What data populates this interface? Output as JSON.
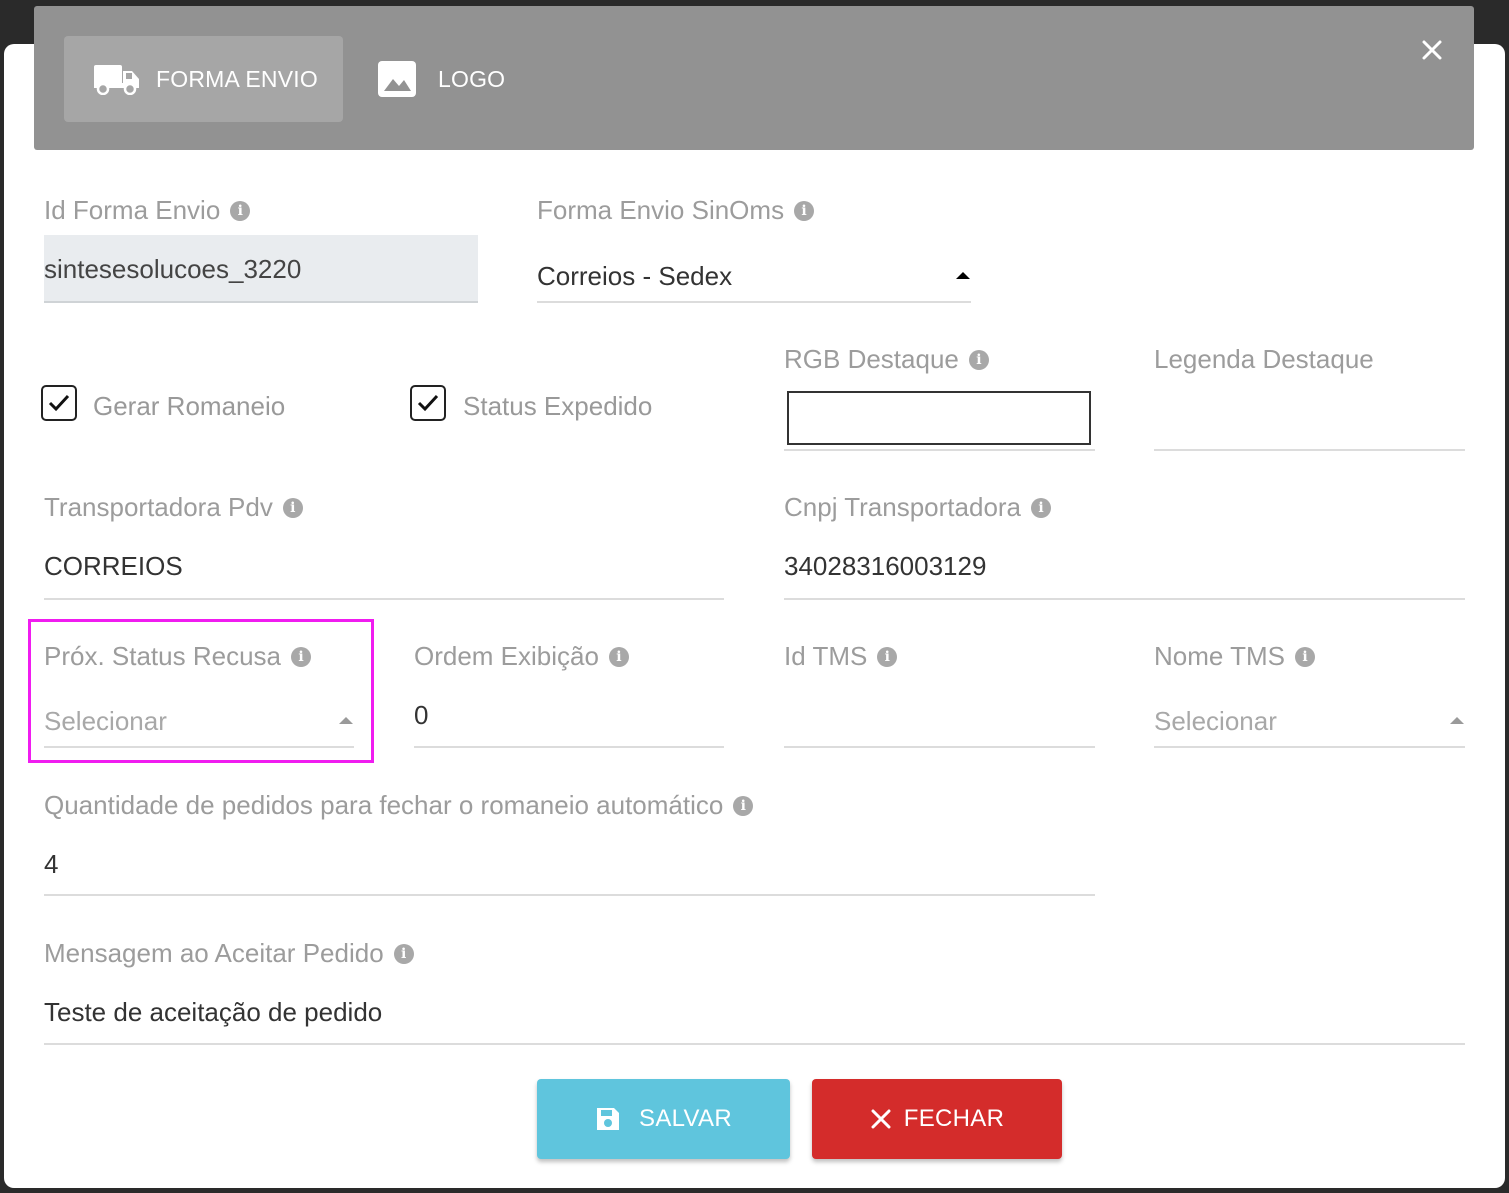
{
  "header": {
    "tabs": [
      {
        "label": "FORMA ENVIO",
        "icon": "truck-icon",
        "active": true
      },
      {
        "label": "LOGO",
        "icon": "image-icon",
        "active": false
      }
    ],
    "close_icon": "close-icon"
  },
  "form": {
    "id_forma_envio": {
      "label": "Id Forma Envio",
      "value": "sintesesolucoes_3220"
    },
    "forma_envio_sinoms": {
      "label": "Forma Envio SinOms",
      "value": "Correios - Sedex"
    },
    "gerar_romaneio": {
      "label": "Gerar Romaneio",
      "checked": true
    },
    "status_expedido": {
      "label": "Status Expedido",
      "checked": true
    },
    "rgb_destaque": {
      "label": "RGB Destaque",
      "value": ""
    },
    "legenda_destaque": {
      "label": "Legenda Destaque",
      "value": ""
    },
    "transportadora_pdv": {
      "label": "Transportadora Pdv",
      "value": "CORREIOS"
    },
    "cnpj_transportadora": {
      "label": "Cnpj Transportadora",
      "value": "34028316003129"
    },
    "prox_status_recusa": {
      "label": "Próx. Status Recusa",
      "placeholder": "Selecionar"
    },
    "ordem_exibicao": {
      "label": "Ordem Exibição",
      "value": "0"
    },
    "id_tms": {
      "label": "Id TMS",
      "value": ""
    },
    "nome_tms": {
      "label": "Nome TMS",
      "placeholder": "Selecionar"
    },
    "quantidade_pedidos": {
      "label": "Quantidade de pedidos para fechar o romaneio automático",
      "value": "4"
    },
    "mensagem_aceitar": {
      "label": "Mensagem ao Aceitar Pedido",
      "value": "Teste de aceitação de pedido"
    }
  },
  "buttons": {
    "salvar": "SALVAR",
    "fechar": "FECHAR"
  },
  "colors": {
    "header_bg": "#929292",
    "salvar_bg": "#5fc5dd",
    "fechar_bg": "#d42c2b",
    "highlight": "#f01cf0"
  }
}
